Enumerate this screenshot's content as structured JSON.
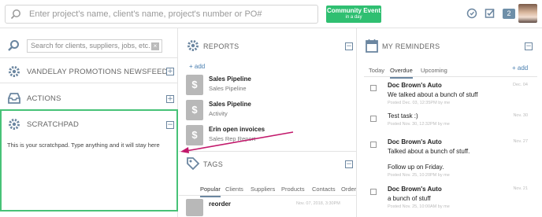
{
  "topbar": {
    "search_placeholder": "Enter project's name, client's name, project's number or PO#",
    "community_title": "Community Event",
    "community_sub": "in a day",
    "badge_count": "2"
  },
  "left": {
    "search_placeholder": "Search for clients, suppliers, jobs, etc.",
    "search_clear": "×",
    "newsfeed_label": "VANDELAY PROMOTIONS NEWSFEED",
    "actions_label": "ACTIONS",
    "scratchpad_label": "SCRATCHPAD",
    "scratchpad_text": "This is your scratchpad. Type anything and it will stay here",
    "expand_symbol": "+",
    "collapse_symbol": "−"
  },
  "reports": {
    "title": "REPORTS",
    "add_label": "+ add",
    "items": [
      {
        "icon": "$",
        "title": "Sales Pipeline",
        "subtitle": "Sales Pipeline"
      },
      {
        "icon": "$",
        "title": "Sales Pipeline",
        "subtitle": "Activity"
      },
      {
        "icon": "$",
        "title": "Erin open invoices",
        "subtitle": "Sales Rep Report"
      }
    ]
  },
  "tags": {
    "title": "TAGS",
    "tabs": [
      "Popular",
      "Clients",
      "Suppliers",
      "Products",
      "Contacts",
      "Order"
    ],
    "items": [
      {
        "title": "reorder",
        "date": "Nov. 07, 2018, 3:30PM"
      }
    ]
  },
  "reminders": {
    "title": "MY REMINDERS",
    "add_label": "+ add",
    "tabs": [
      "Today",
      "Overdue",
      "Upcoming"
    ],
    "items": [
      {
        "title": "Doc Brown's Auto",
        "body": "We talked about a bunch of stuff",
        "posted": "Posted Dec. 03, 12:35PM by me",
        "date": "Dec. 04"
      },
      {
        "title": "Test task :)",
        "body": "",
        "posted": "Posted Nov. 30, 12:32PM by me",
        "date": "Nov. 30"
      },
      {
        "title": "Doc Brown's Auto",
        "body": "Talked about a bunch of stuff.",
        "posted": "",
        "date": "Nov. 27"
      },
      {
        "title": "Follow up on Friday.",
        "body": "",
        "posted": "Posted Nov. 25, 10:20PM by me",
        "date": ""
      },
      {
        "title": "Doc Brown's Auto",
        "body": "a bunch of stuff",
        "posted": "Posted Nov. 25, 10:00AM by me",
        "date": "Nov. 21"
      }
    ]
  },
  "colors": {
    "accent_green": "#47c277",
    "button_green": "#2fbf71",
    "icon_blue": "#6b86a0",
    "annotation_arrow": "#c2186b"
  }
}
